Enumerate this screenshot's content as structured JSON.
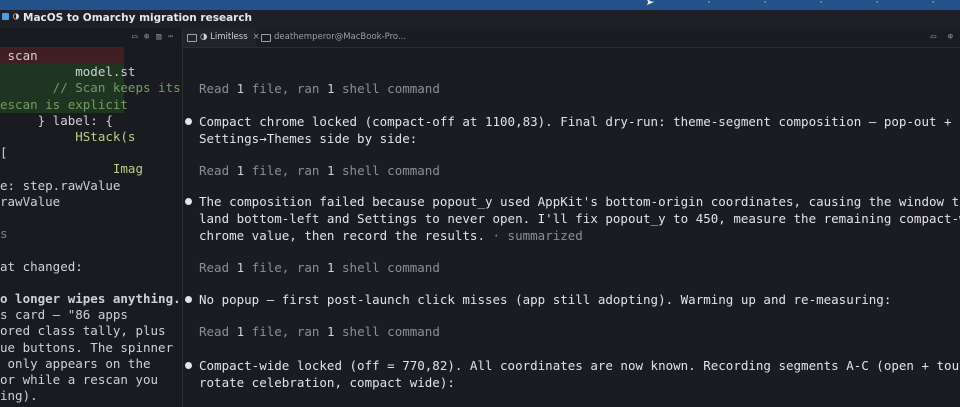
{
  "window": {
    "title": "MacOS to Omarchy migration research",
    "icon": "folder-icon"
  },
  "tabs": [
    {
      "label": "◑ Limitless",
      "close": "×"
    },
    {
      "label": "deathemperor@MacBook-Pro..."
    }
  ],
  "left_code": [
    {
      "text": " scan",
      "style": "bg-red",
      "color": "default"
    },
    {
      "text": "          model.st",
      "style": "bg-green",
      "color": "default"
    },
    {
      "text": "       // Scan keeps its",
      "style": "bg-green",
      "color": "comment"
    },
    {
      "text": "escan is explicit",
      "style": "bg-green",
      "color": "comment"
    },
    {
      "text": "     } label: {",
      "style": "",
      "color": "default"
    },
    {
      "text": "          HStack(s",
      "style": "",
      "color": "type"
    },
    {
      "text": "[",
      "style": "",
      "color": "default"
    },
    {
      "text": "               Imag",
      "style": "",
      "color": "type"
    },
    {
      "text": "e: step.rawValue",
      "style": "",
      "color": "default"
    },
    {
      "text": "rawValue",
      "style": "",
      "color": "default"
    },
    {
      "text": "",
      "style": "",
      "color": "default"
    },
    {
      "text": "s",
      "style": "",
      "color": "dim"
    },
    {
      "text": "",
      "style": "",
      "color": "default"
    },
    {
      "text": "at changed:",
      "style": "",
      "color": "default"
    },
    {
      "text": "",
      "style": "",
      "color": "default"
    },
    {
      "text": "o longer wipes anything.",
      "style": "",
      "color": "default",
      "bold": true
    },
    {
      "text": "s card — \"86 apps",
      "style": "",
      "color": "default"
    },
    {
      "text": "ored class tally, plus",
      "style": "",
      "color": "default"
    },
    {
      "text": "ue buttons. The spinner",
      "style": "",
      "color": "default"
    },
    {
      "text": " only appears on the",
      "style": "",
      "color": "default"
    },
    {
      "text": "or while a rescan you",
      "style": "",
      "color": "default"
    },
    {
      "text": "ing).",
      "style": "",
      "color": "default"
    }
  ],
  "transcript": {
    "ran_label": "Read 1 file, ran 1 shell command",
    "messages": [
      {
        "text": "Compact chrome locked (compact-off at 1100,83). Final dry-run: theme-segment composition — pop-out +\nSettings→Themes side by side:"
      },
      {
        "text": "The composition failed because popout_y used AppKit's bottom-origin coordinates, causing the window to\nland bottom-left and Settings to never open. I'll fix popout_y to 450, measure the remaining compact-w\nchrome value, then record the results.",
        "suffix": " · summarized"
      },
      {
        "text": "No popup — first post-launch click misses (app still adopting). Warming up and re-measuring:"
      },
      {
        "text": "Compact-wide locked (off = 770,82). All coordinates are now known. Recording segments A-C (open + tour\nrotate celebration, compact wide):"
      }
    ]
  },
  "colors": {
    "accent": "#23528a",
    "background": "#1b1c21",
    "diff_removed": "#3f1f22",
    "diff_added": "#1f3521"
  }
}
